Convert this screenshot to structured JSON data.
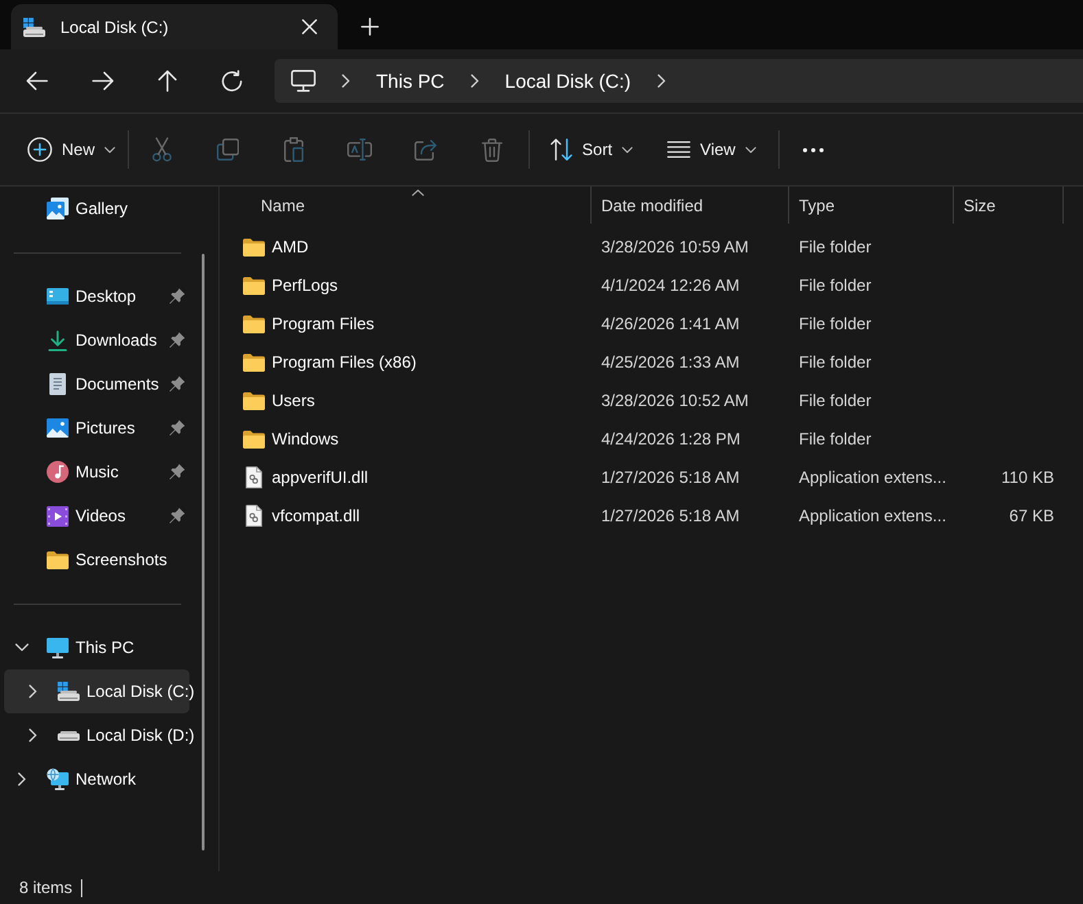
{
  "tabs": [
    {
      "title": "Local Disk (C:)",
      "selected": true
    }
  ],
  "address_bar": {
    "breadcrumbs": [
      "This PC",
      "Local Disk (C:)"
    ]
  },
  "toolbar": {
    "new_button": {
      "label": "New"
    },
    "actions": [
      {
        "kind": "cut",
        "disabled": true
      },
      {
        "kind": "copy",
        "disabled": true
      },
      {
        "kind": "paste",
        "disabled": true
      },
      {
        "kind": "rename",
        "disabled": true
      },
      {
        "kind": "share",
        "disabled": true
      },
      {
        "kind": "delete",
        "disabled": true
      }
    ],
    "sort_button": {
      "label": "Sort"
    },
    "view_button": {
      "label": "View"
    }
  },
  "sidebar": {
    "gallery": {
      "label": "Gallery",
      "selected": false
    },
    "quick_access": [
      {
        "kind": "desktop",
        "label": "Desktop",
        "pinned": true,
        "selected": false
      },
      {
        "kind": "downloads",
        "label": "Downloads",
        "pinned": true,
        "selected": false
      },
      {
        "kind": "documents",
        "label": "Documents",
        "pinned": true,
        "selected": false
      },
      {
        "kind": "pictures",
        "label": "Pictures",
        "pinned": true,
        "selected": false
      },
      {
        "kind": "music",
        "label": "Music",
        "pinned": true,
        "selected": false
      },
      {
        "kind": "videos",
        "label": "Videos",
        "pinned": true,
        "selected": false
      },
      {
        "kind": "folder",
        "label": "Screenshots",
        "pinned": false,
        "selected": false
      }
    ],
    "tree": [
      {
        "kind": "pc",
        "label": "This PC",
        "expanded": true,
        "selected": false,
        "children": [
          {
            "kind": "system-drive",
            "label": "Local Disk (C:)",
            "expanded": false,
            "selected": true
          },
          {
            "kind": "drive",
            "label": "Local Disk (D:)",
            "expanded": false,
            "selected": false
          }
        ]
      },
      {
        "kind": "network",
        "label": "Network",
        "expanded": false,
        "selected": false
      }
    ]
  },
  "file_list": {
    "columns": [
      {
        "label": "Name",
        "sorted": true
      },
      {
        "label": "Date modified",
        "sorted": false
      },
      {
        "label": "Type",
        "sorted": false
      },
      {
        "label": "Size",
        "sorted": false
      }
    ],
    "rows": [
      {
        "kind": "folder",
        "name": "AMD",
        "date_modified": "3/28/2026 10:59 AM",
        "type": "File folder",
        "selected": false
      },
      {
        "kind": "folder",
        "name": "PerfLogs",
        "date_modified": "4/1/2024 12:26 AM",
        "type": "File folder",
        "selected": false
      },
      {
        "kind": "folder",
        "name": "Program Files",
        "date_modified": "4/26/2026 1:41 AM",
        "type": "File folder",
        "selected": false
      },
      {
        "kind": "folder",
        "name": "Program Files (x86)",
        "date_modified": "4/25/2026 1:33 AM",
        "type": "File folder",
        "selected": false
      },
      {
        "kind": "folder",
        "name": "Users",
        "date_modified": "3/28/2026 10:52 AM",
        "type": "File folder",
        "selected": false
      },
      {
        "kind": "folder",
        "name": "Windows",
        "date_modified": "4/24/2026 1:28 PM",
        "type": "File folder",
        "selected": false
      },
      {
        "kind": "file",
        "name": "appverifUI.dll",
        "date_modified": "1/27/2026 5:18 AM",
        "type": "Application extens...",
        "size": "110 KB",
        "selected": false
      },
      {
        "kind": "file",
        "name": "vfcompat.dll",
        "date_modified": "1/27/2026 5:18 AM",
        "type": "Application extens...",
        "size": "67 KB",
        "selected": false
      }
    ]
  },
  "status_bar": {
    "item_count": "8 items"
  }
}
